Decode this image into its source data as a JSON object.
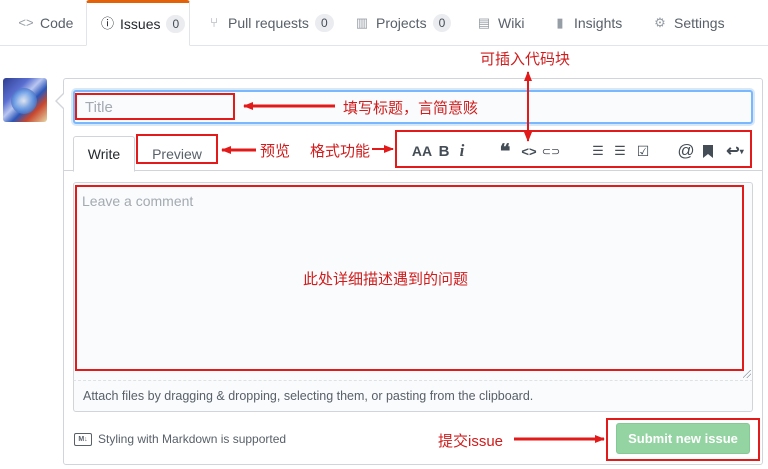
{
  "tabs": [
    {
      "label": "Code",
      "icon": "code-icon"
    },
    {
      "label": "Issues",
      "icon": "issue-opened-icon",
      "count": "0",
      "active": true
    },
    {
      "label": "Pull requests",
      "icon": "git-pull-request-icon",
      "count": "0"
    },
    {
      "label": "Projects",
      "icon": "project-icon",
      "count": "0"
    },
    {
      "label": "Wiki",
      "icon": "book-icon"
    },
    {
      "label": "Insights",
      "icon": "graph-icon"
    },
    {
      "label": "Settings",
      "icon": "gear-icon"
    }
  ],
  "form": {
    "title_placeholder": "Title",
    "write_tab": "Write",
    "preview_tab": "Preview",
    "comment_placeholder": "Leave a comment",
    "attach_text": "Attach files by dragging & dropping, selecting them, or pasting from the clipboard.",
    "markdown_hint": "Styling with Markdown is supported",
    "markdown_icon": "M↓",
    "submit_label": "Submit new issue"
  },
  "toolbar": {
    "header": "AA",
    "bold": "B",
    "italic": "i",
    "quote": "❝",
    "code": "<>",
    "link": "⊂⊃",
    "ul": "☰",
    "ol": "☰",
    "tasklist": "☑",
    "mention": "@",
    "bookmark": "🔖",
    "reply": "↩"
  },
  "annotations": {
    "title_note": "填写标题，言简意赅",
    "preview_note": "预览",
    "format_note": "格式功能",
    "code_note": "可插入代码块",
    "body_note": "此处详细描述遇到的问题",
    "submit_note": "提交issue"
  },
  "colors": {
    "annotation_red": "#e31a1a",
    "tab_accent": "#e36209",
    "submit_green": "#94d3a2",
    "focus_blue": "#79b8ff"
  }
}
